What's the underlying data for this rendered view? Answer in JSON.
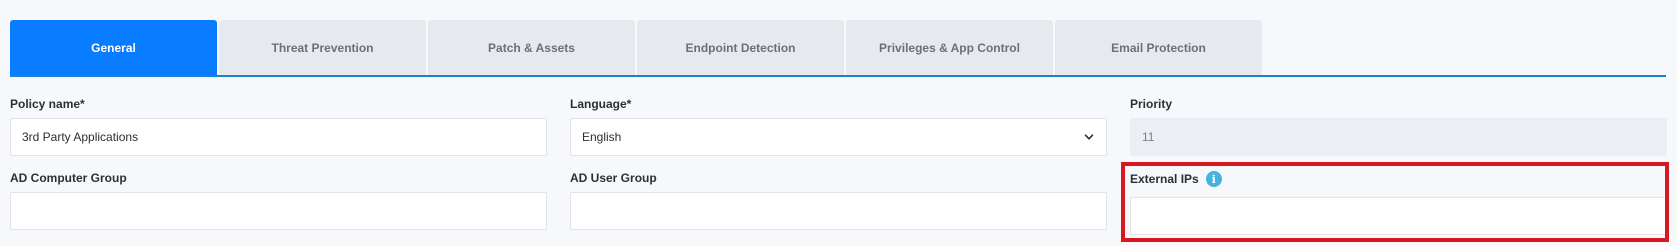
{
  "tabs": [
    {
      "label": "General",
      "active": true
    },
    {
      "label": "Threat Prevention",
      "active": false
    },
    {
      "label": "Patch & Assets",
      "active": false
    },
    {
      "label": "Endpoint Detection",
      "active": false
    },
    {
      "label": "Privileges & App Control",
      "active": false
    },
    {
      "label": "Email Protection",
      "active": false
    }
  ],
  "form": {
    "policy_name": {
      "label": "Policy name*",
      "value": "3rd Party Applications"
    },
    "language": {
      "label": "Language*",
      "value": "English"
    },
    "priority": {
      "label": "Priority",
      "value": "11"
    },
    "ad_computer_group": {
      "label": "AD Computer Group",
      "value": ""
    },
    "ad_user_group": {
      "label": "AD User Group",
      "value": ""
    },
    "external_ips": {
      "label": "External IPs",
      "value": "",
      "info_icon": "info-icon"
    }
  },
  "colors": {
    "active_tab": "#0a7cff",
    "inactive_tab": "#e8e9ee",
    "tab_underline": "#1a84c7",
    "info_icon": "#47b3dc",
    "highlight_box": "#d7181f"
  }
}
